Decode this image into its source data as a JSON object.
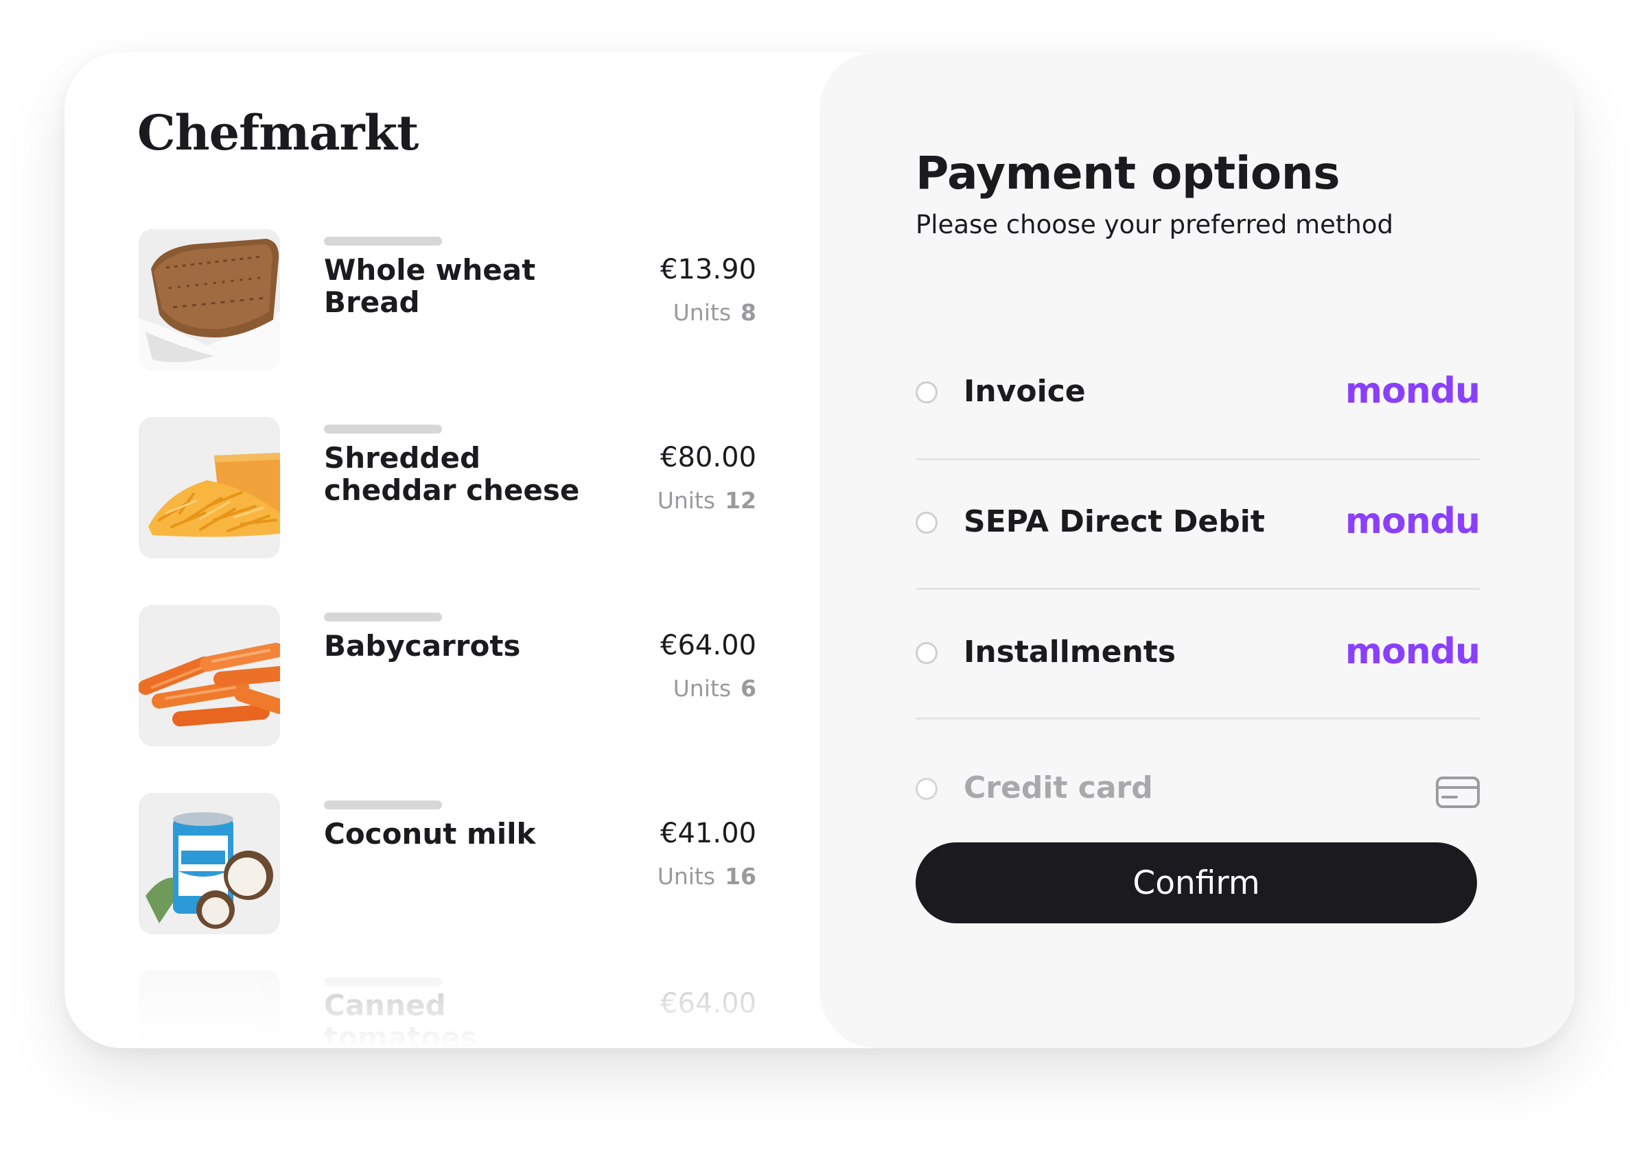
{
  "brand": {
    "name": "Chefmarkt"
  },
  "cart": {
    "units_label": "Units",
    "items": [
      {
        "name": "Whole wheat Bread",
        "price": "€13.90",
        "units": "8",
        "image": "bread-photo"
      },
      {
        "name": "Shredded cheddar cheese",
        "price": "€80.00",
        "units": "12",
        "image": "cheese-photo"
      },
      {
        "name": "Babycarrots",
        "price": "€64.00",
        "units": "6",
        "image": "carrots-photo"
      },
      {
        "name": "Coconut milk",
        "price": "€41.00",
        "units": "16",
        "image": "coconut-milk-photo"
      },
      {
        "name": "Canned tomatoes",
        "price": "€64.00",
        "units": "",
        "image": "tomatoes-photo"
      }
    ]
  },
  "payment": {
    "title": "Payment options",
    "subtitle": "Please choose your preferred method",
    "options": [
      {
        "label": "Invoice",
        "provider": "mondu",
        "icon": "mondu-logo",
        "selected": false,
        "disabled": false
      },
      {
        "label": "SEPA Direct Debit",
        "provider": "mondu",
        "icon": "mondu-logo",
        "selected": false,
        "disabled": false
      },
      {
        "label": "Installments",
        "provider": "mondu",
        "icon": "mondu-logo",
        "selected": false,
        "disabled": false
      },
      {
        "label": "Credit card",
        "provider": "",
        "icon": "credit-card-icon",
        "selected": false,
        "disabled": true
      }
    ],
    "confirm_label": "Confirm"
  },
  "colors": {
    "accent": "#8a3ffc",
    "button": "#1b1b1f",
    "panel": "#f7f7f7",
    "muted_text": "#9a9a9e"
  }
}
